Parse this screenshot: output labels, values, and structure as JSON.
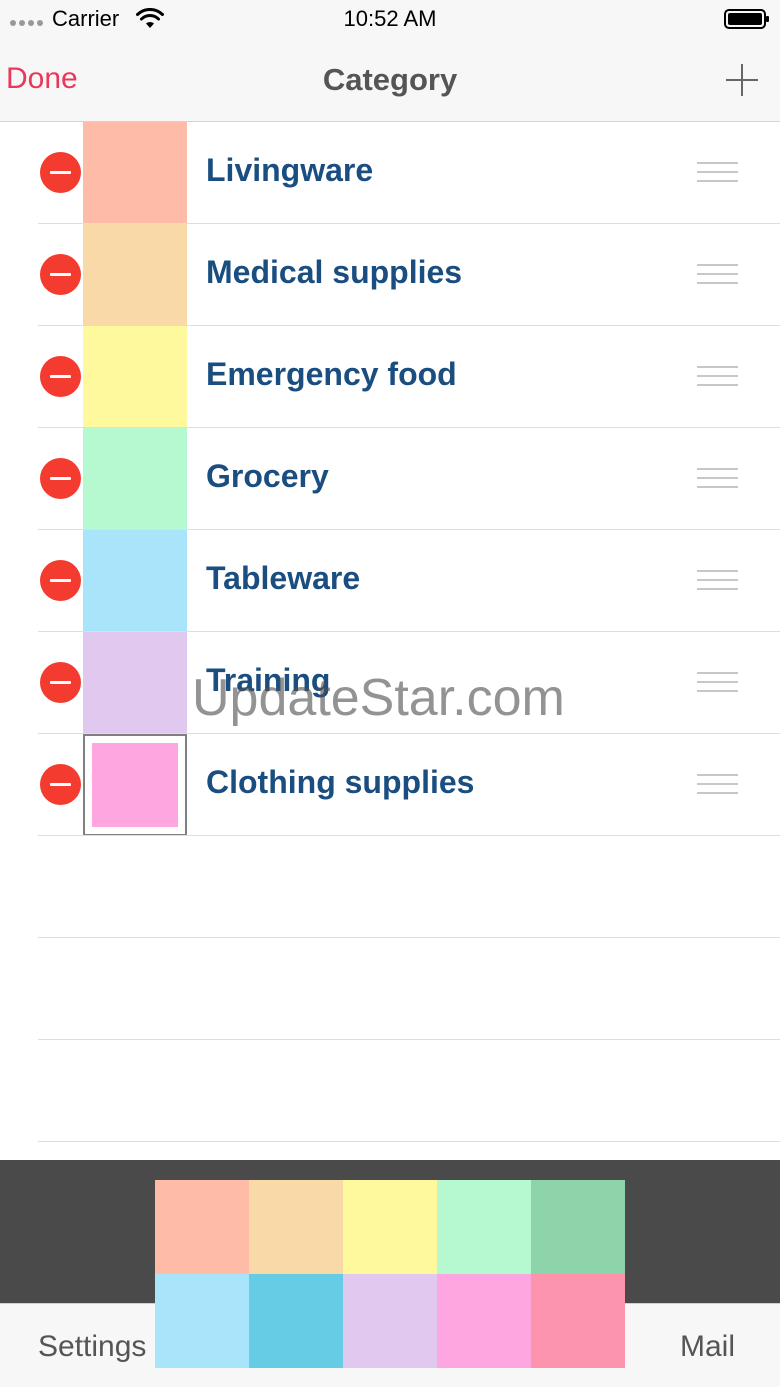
{
  "status_bar": {
    "carrier": "Carrier",
    "time": "10:52 AM"
  },
  "nav": {
    "done_label": "Done",
    "title": "Category",
    "add_icon": "plus-icon"
  },
  "categories": [
    {
      "label": "Livingware",
      "color": "#fdbba8",
      "selected": false
    },
    {
      "label": "Medical supplies",
      "color": "#f9d9a8",
      "selected": false
    },
    {
      "label": "Emergency food",
      "color": "#fdf99c",
      "selected": false
    },
    {
      "label": "Grocery",
      "color": "#b6f9d0",
      "selected": false
    },
    {
      "label": "Tableware",
      "color": "#a8e5fa",
      "selected": false
    },
    {
      "label": "Training",
      "color": "#e1c8ef",
      "selected": false
    },
    {
      "label": "Clothing supplies",
      "color": "#fda6e0",
      "selected": true
    }
  ],
  "watermark": "UpdateStar.com",
  "palette": [
    "#fdbba8",
    "#f9d9a8",
    "#fdf99c",
    "#b6f9d0",
    "#8ed4aa",
    "#a8e5fa",
    "#66cce6",
    "#e1c8ef",
    "#fda6e0",
    "#fd94ad"
  ],
  "tab_bar": {
    "settings_label": "Settings",
    "mail_label": "Mail"
  },
  "colors": {
    "accent": "#e8395a",
    "label": "#1a4d80",
    "delete": "#f33b2f"
  }
}
